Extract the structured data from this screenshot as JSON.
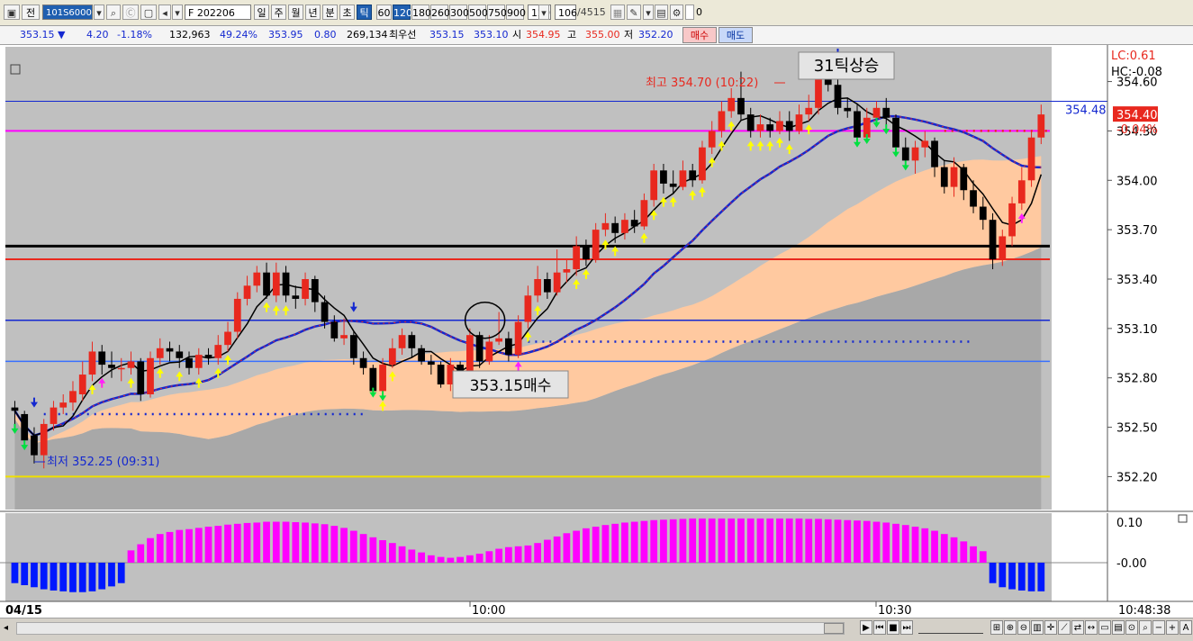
{
  "toolbar": {
    "jeon": "전",
    "symbol_code": "101S6000",
    "symbol_name": "F 202206",
    "periods": [
      "일",
      "주",
      "월",
      "년",
      "분",
      "초",
      "틱"
    ],
    "tick_sizes": [
      "60",
      "120",
      "180",
      "260",
      "300",
      "500",
      "750",
      "900"
    ],
    "tick_value": "120",
    "count_value": "106",
    "count_total": "/4515",
    "checkbox_label": "0"
  },
  "quote": {
    "price": "353.15 ▼",
    "change": "4.20",
    "change_pct": "-1.18%",
    "volume": "132,963",
    "volume_pct": "49.24%",
    "basis": "353.95",
    "basis_diff": "0.80",
    "open_interest": "269,134",
    "front_label": "최우선",
    "bid": "353.15",
    "ask": "353.10",
    "open_label": "시",
    "open": "354.95",
    "high_label": "고",
    "high": "355.00",
    "low_label": "저",
    "low": "352.20",
    "buy_label": "매수",
    "sell_label": "매도"
  },
  "colors": {
    "up": "#e8281e",
    "down": "#000000",
    "ma_blue": "#1428d0",
    "magenta_line": "#ff00ff",
    "red_line": "#e8281e",
    "yellow_line": "#f0e000",
    "band_fill": "#ffc9a0",
    "gray_fill": "#a8a8a8",
    "plot_bg": "#c0c0c0",
    "osc_pos": "#ff00ff",
    "osc_neg": "#0018ff"
  },
  "chart_data": {
    "type": "candlestick",
    "title": "",
    "x_tick_labels": [
      "04/15",
      "10:00",
      "10:30"
    ],
    "y_ticks": [
      354.6,
      354.3,
      354.0,
      353.7,
      353.4,
      353.1,
      352.8,
      352.5,
      352.2
    ],
    "y_tick_labels": [
      "354.60",
      "354.30",
      "354.00",
      "353.70",
      "353.40",
      "353.10",
      "352.80",
      "352.50",
      "352.20"
    ],
    "ylim": [
      352.0,
      354.8
    ],
    "candles": [
      [
        352.62,
        352.6,
        352.66,
        352.48
      ],
      [
        352.58,
        352.42,
        352.6,
        352.38
      ],
      [
        352.45,
        352.33,
        352.5,
        352.28
      ],
      [
        352.33,
        352.52,
        352.55,
        352.25
      ],
      [
        352.52,
        352.62,
        352.66,
        352.48
      ],
      [
        352.62,
        352.65,
        352.7,
        352.58
      ],
      [
        352.65,
        352.72,
        352.78,
        352.6
      ],
      [
        352.7,
        352.82,
        352.9,
        352.66
      ],
      [
        352.82,
        352.96,
        353.02,
        352.78
      ],
      [
        352.96,
        352.88,
        353.0,
        352.82
      ],
      [
        352.88,
        352.86,
        352.96,
        352.8
      ],
      [
        352.86,
        352.86,
        352.92,
        352.78
      ],
      [
        352.86,
        352.9,
        352.96,
        352.82
      ],
      [
        352.9,
        352.7,
        352.92,
        352.66
      ],
      [
        352.7,
        352.92,
        352.96,
        352.68
      ],
      [
        352.92,
        352.98,
        353.04,
        352.88
      ],
      [
        352.98,
        352.96,
        353.02,
        352.9
      ],
      [
        352.96,
        352.92,
        353.0,
        352.86
      ],
      [
        352.92,
        352.86,
        352.96,
        352.82
      ],
      [
        352.86,
        352.94,
        352.98,
        352.82
      ],
      [
        352.94,
        352.92,
        352.98,
        352.88
      ],
      [
        352.92,
        353.0,
        353.06,
        352.88
      ],
      [
        353.0,
        353.08,
        353.14,
        352.96
      ],
      [
        353.08,
        353.28,
        353.32,
        353.04
      ],
      [
        353.28,
        353.36,
        353.42,
        353.24
      ],
      [
        353.36,
        353.44,
        353.48,
        353.32
      ],
      [
        353.44,
        353.3,
        353.5,
        353.28
      ],
      [
        353.3,
        353.44,
        353.5,
        353.26
      ],
      [
        353.44,
        353.3,
        353.48,
        353.26
      ],
      [
        353.3,
        353.28,
        353.36,
        353.22
      ],
      [
        353.28,
        353.4,
        353.44,
        353.24
      ],
      [
        353.4,
        353.26,
        353.42,
        353.2
      ],
      [
        353.26,
        353.14,
        353.3,
        353.1
      ],
      [
        353.14,
        353.04,
        353.18,
        353.02
      ],
      [
        353.04,
        353.06,
        353.16,
        353.0
      ],
      [
        353.06,
        352.92,
        353.08,
        352.88
      ],
      [
        352.92,
        352.86,
        352.96,
        352.82
      ],
      [
        352.86,
        352.72,
        352.88,
        352.7
      ],
      [
        352.72,
        352.88,
        352.92,
        352.68
      ],
      [
        352.88,
        352.98,
        353.04,
        352.86
      ],
      [
        352.98,
        353.06,
        353.1,
        352.94
      ],
      [
        353.06,
        352.98,
        353.08,
        352.92
      ],
      [
        352.98,
        352.9,
        353.0,
        352.88
      ],
      [
        352.9,
        352.88,
        352.94,
        352.82
      ],
      [
        352.88,
        352.76,
        352.9,
        352.74
      ],
      [
        352.76,
        352.88,
        352.92,
        352.72
      ],
      [
        352.88,
        352.78,
        352.9,
        352.74
      ],
      [
        352.78,
        353.06,
        353.1,
        352.76
      ],
      [
        353.06,
        352.9,
        353.08,
        352.86
      ],
      [
        352.9,
        353.02,
        353.06,
        352.88
      ],
      [
        353.02,
        353.04,
        353.2,
        353.0
      ],
      [
        353.04,
        352.94,
        353.08,
        352.9
      ],
      [
        352.94,
        353.14,
        353.18,
        352.92
      ],
      [
        353.14,
        353.3,
        353.36,
        353.1
      ],
      [
        353.3,
        353.4,
        353.48,
        353.26
      ],
      [
        353.4,
        353.32,
        353.44,
        353.28
      ],
      [
        353.32,
        353.44,
        353.58,
        353.3
      ],
      [
        353.44,
        353.46,
        353.52,
        353.38
      ],
      [
        353.46,
        353.6,
        353.66,
        353.42
      ],
      [
        353.6,
        353.52,
        353.64,
        353.48
      ],
      [
        353.52,
        353.7,
        353.74,
        353.5
      ],
      [
        353.7,
        353.74,
        353.8,
        353.66
      ],
      [
        353.74,
        353.68,
        353.78,
        353.62
      ],
      [
        353.68,
        353.76,
        353.8,
        353.64
      ],
      [
        353.76,
        353.72,
        353.82,
        353.68
      ],
      [
        353.72,
        353.88,
        353.92,
        353.7
      ],
      [
        353.88,
        354.06,
        354.1,
        353.84
      ],
      [
        354.06,
        353.98,
        354.1,
        353.92
      ],
      [
        353.98,
        353.96,
        354.06,
        353.92
      ],
      [
        353.96,
        354.06,
        354.12,
        353.94
      ],
      [
        354.06,
        354.0,
        354.1,
        353.96
      ],
      [
        354.0,
        354.2,
        354.24,
        353.98
      ],
      [
        354.2,
        354.3,
        354.36,
        354.16
      ],
      [
        354.3,
        354.42,
        354.48,
        354.26
      ],
      [
        354.42,
        354.5,
        354.56,
        354.38
      ],
      [
        354.5,
        354.4,
        354.66,
        354.36
      ],
      [
        354.4,
        354.3,
        354.44,
        354.26
      ],
      [
        354.3,
        354.34,
        354.4,
        354.26
      ],
      [
        354.34,
        354.3,
        354.38,
        354.26
      ],
      [
        354.3,
        354.36,
        354.42,
        354.28
      ],
      [
        354.36,
        354.3,
        354.42,
        354.24
      ],
      [
        354.3,
        354.4,
        354.46,
        354.28
      ],
      [
        354.4,
        354.44,
        354.52,
        354.36
      ],
      [
        354.44,
        354.62,
        354.68,
        354.4
      ],
      [
        354.62,
        354.58,
        354.7,
        354.54
      ],
      [
        354.58,
        354.44,
        354.62,
        354.4
      ],
      [
        354.44,
        354.42,
        354.5,
        354.38
      ],
      [
        354.42,
        354.26,
        354.46,
        354.22
      ],
      [
        354.26,
        354.38,
        354.44,
        354.24
      ],
      [
        354.38,
        354.44,
        354.48,
        354.34
      ],
      [
        354.44,
        354.38,
        354.5,
        354.3
      ],
      [
        354.38,
        354.2,
        354.4,
        354.16
      ],
      [
        354.2,
        354.12,
        354.26,
        354.08
      ],
      [
        354.12,
        354.2,
        354.24,
        354.04
      ],
      [
        354.2,
        354.24,
        354.3,
        354.14
      ],
      [
        354.24,
        354.08,
        354.26,
        354.02
      ],
      [
        354.08,
        353.96,
        354.12,
        353.92
      ],
      [
        353.96,
        354.08,
        354.14,
        353.9
      ],
      [
        354.08,
        353.94,
        354.1,
        353.88
      ],
      [
        353.94,
        353.84,
        354.0,
        353.8
      ],
      [
        353.84,
        353.76,
        353.9,
        353.7
      ],
      [
        353.76,
        353.52,
        353.8,
        353.46
      ],
      [
        353.52,
        353.66,
        353.7,
        353.48
      ],
      [
        353.66,
        353.86,
        353.9,
        353.6
      ],
      [
        353.86,
        354.0,
        354.08,
        353.82
      ],
      [
        354.0,
        354.26,
        354.3,
        353.96
      ],
      [
        354.26,
        354.4,
        354.46,
        354.22
      ]
    ],
    "annotations": {
      "top_signal": "31틱상승",
      "buy_signal": "353.15매수",
      "high_label": "최고 354.70 (10:22)",
      "low_label": "최저 352.25 (09:31)",
      "lc_label": "LC:0.61",
      "hc_label": "HC:-0.08",
      "ma_last_label": "354.48",
      "price_last_label": "354.40",
      "pct_label": "-0.04%"
    },
    "levels": {
      "blue_top": 354.48,
      "magenta": 354.3,
      "black": 353.6,
      "red": 353.52,
      "blue_mid": 353.15,
      "blue_low": 352.9,
      "yellow": 352.2
    },
    "osc_ticks": [
      "0.10",
      "-0.00"
    ],
    "time_label": "10:48:38",
    "oscillator": [
      -0.05,
      -0.055,
      -0.06,
      -0.065,
      -0.068,
      -0.07,
      -0.072,
      -0.072,
      -0.07,
      -0.065,
      -0.058,
      -0.05,
      0.03,
      0.045,
      0.06,
      0.07,
      0.075,
      0.08,
      0.082,
      0.085,
      0.088,
      0.09,
      0.093,
      0.095,
      0.097,
      0.098,
      0.1,
      0.1,
      0.1,
      0.099,
      0.098,
      0.096,
      0.094,
      0.09,
      0.085,
      0.078,
      0.07,
      0.062,
      0.055,
      0.048,
      0.04,
      0.032,
      0.025,
      0.018,
      0.014,
      0.012,
      0.014,
      0.018,
      0.022,
      0.028,
      0.034,
      0.038,
      0.04,
      0.042,
      0.048,
      0.056,
      0.064,
      0.072,
      0.078,
      0.084,
      0.088,
      0.092,
      0.095,
      0.098,
      0.1,
      0.102,
      0.104,
      0.105,
      0.106,
      0.107,
      0.108,
      0.108,
      0.108,
      0.108,
      0.108,
      0.108,
      0.108,
      0.108,
      0.108,
      0.108,
      0.108,
      0.108,
      0.107,
      0.107,
      0.106,
      0.105,
      0.104,
      0.103,
      0.102,
      0.1,
      0.098,
      0.095,
      0.092,
      0.088,
      0.084,
      0.078,
      0.07,
      0.062,
      0.052,
      0.04,
      0.028,
      -0.05,
      -0.06,
      -0.065,
      -0.068,
      -0.07,
      -0.07,
      -0.069,
      -0.068
    ]
  }
}
